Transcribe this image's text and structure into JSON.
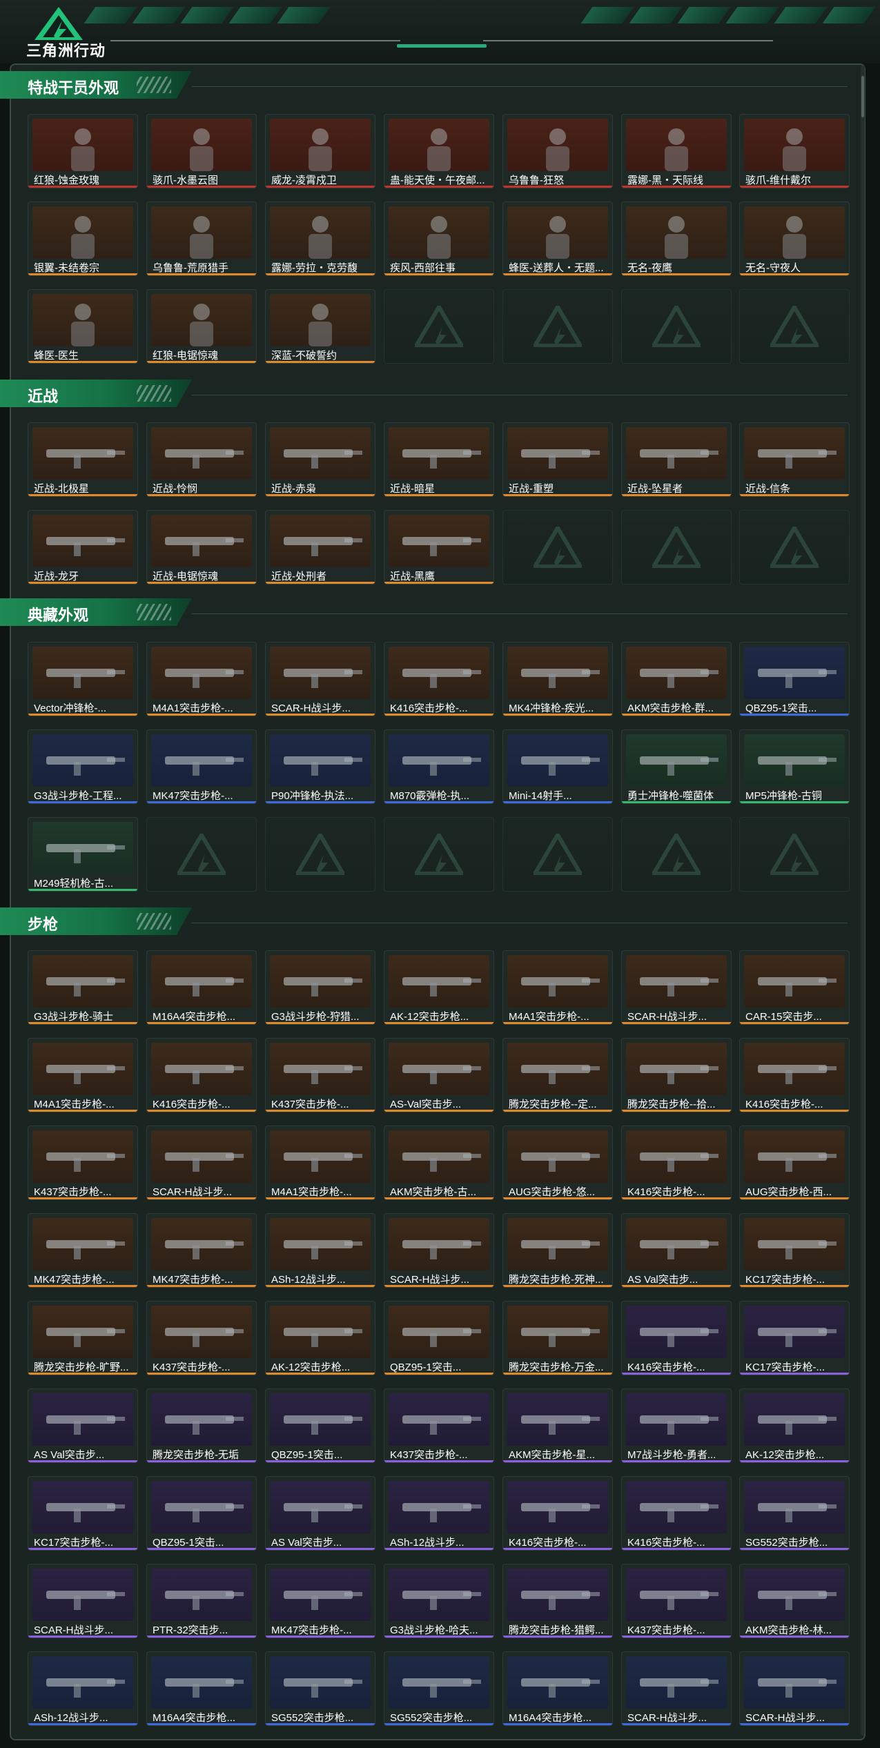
{
  "header": {
    "title": "三角洲行动"
  },
  "colors": {
    "accent": "#1f8a55",
    "red": "#c2332b",
    "gold": "#e0892c",
    "blue": "#3f69e0",
    "purple": "#8c5fe0",
    "green": "#34b86d"
  },
  "sections": [
    {
      "title": "特战干员外观",
      "items": [
        {
          "name": "红狼-蚀金玫瑰",
          "rarity": "red"
        },
        {
          "name": "骇爪-水墨云图",
          "rarity": "red"
        },
        {
          "name": "威龙-凌霄戍卫",
          "rarity": "red"
        },
        {
          "name": "蛊-能天使・午夜邮...",
          "rarity": "red"
        },
        {
          "name": "乌鲁鲁-狂怒",
          "rarity": "red"
        },
        {
          "name": "露娜-黑・天际线",
          "rarity": "red"
        },
        {
          "name": "骇爪-维什戴尔",
          "rarity": "red"
        },
        {
          "name": "银翼-未结卷宗",
          "rarity": "gold"
        },
        {
          "name": "乌鲁鲁-荒原猎手",
          "rarity": "gold"
        },
        {
          "name": "露娜-劳拉・克劳馥",
          "rarity": "gold"
        },
        {
          "name": "疾风-西部往事",
          "rarity": "gold"
        },
        {
          "name": "蜂医-送葬人・无题...",
          "rarity": "gold"
        },
        {
          "name": "无名-夜鹰",
          "rarity": "gold"
        },
        {
          "name": "无名-守夜人",
          "rarity": "gold"
        },
        {
          "name": "蜂医-医生",
          "rarity": "gold"
        },
        {
          "name": "红狼-电锯惊魂",
          "rarity": "gold"
        },
        {
          "name": "深蓝-不破誓约",
          "rarity": "gold"
        }
      ]
    },
    {
      "title": "近战",
      "items": [
        {
          "name": "近战-北极星",
          "rarity": "gold"
        },
        {
          "name": "近战-怜悯",
          "rarity": "gold"
        },
        {
          "name": "近战-赤枭",
          "rarity": "gold"
        },
        {
          "name": "近战-暗星",
          "rarity": "gold"
        },
        {
          "name": "近战-重塑",
          "rarity": "gold"
        },
        {
          "name": "近战-坠星者",
          "rarity": "gold"
        },
        {
          "name": "近战-信条",
          "rarity": "gold"
        },
        {
          "name": "近战-龙牙",
          "rarity": "gold"
        },
        {
          "name": "近战-电锯惊魂",
          "rarity": "gold"
        },
        {
          "name": "近战-处刑者",
          "rarity": "gold"
        },
        {
          "name": "近战-黑鹰",
          "rarity": "gold"
        }
      ]
    },
    {
      "title": "典藏外观",
      "items": [
        {
          "name": "Vector冲锋枪-...",
          "rarity": "gold"
        },
        {
          "name": "M4A1突击步枪-...",
          "rarity": "gold"
        },
        {
          "name": "SCAR-H战斗步...",
          "rarity": "gold"
        },
        {
          "name": "K416突击步枪-...",
          "rarity": "gold"
        },
        {
          "name": "MK4冲锋枪-疾光...",
          "rarity": "gold"
        },
        {
          "name": "AKM突击步枪-群...",
          "rarity": "gold"
        },
        {
          "name": "QBZ95-1突击...",
          "rarity": "blue"
        },
        {
          "name": "G3战斗步枪-工程...",
          "rarity": "blue"
        },
        {
          "name": "MK47突击步枪-...",
          "rarity": "blue"
        },
        {
          "name": "P90冲锋枪-执法...",
          "rarity": "blue"
        },
        {
          "name": "M870霰弹枪-执...",
          "rarity": "blue"
        },
        {
          "name": "Mini-14射手...",
          "rarity": "blue"
        },
        {
          "name": "勇士冲锋枪-噬菌体",
          "rarity": "green"
        },
        {
          "name": "MP5冲锋枪-古铜",
          "rarity": "green"
        },
        {
          "name": "M249轻机枪-古...",
          "rarity": "green"
        }
      ]
    },
    {
      "title": "步枪",
      "items": [
        {
          "name": "G3战斗步枪-骑士",
          "rarity": "gold"
        },
        {
          "name": "M16A4突击步枪...",
          "rarity": "gold"
        },
        {
          "name": "G3战斗步枪-狩猎...",
          "rarity": "gold"
        },
        {
          "name": "AK-12突击步枪...",
          "rarity": "gold"
        },
        {
          "name": "M4A1突击步枪-...",
          "rarity": "gold"
        },
        {
          "name": "SCAR-H战斗步...",
          "rarity": "gold"
        },
        {
          "name": "CAR-15突击步...",
          "rarity": "gold"
        },
        {
          "name": "M4A1突击步枪-...",
          "rarity": "gold"
        },
        {
          "name": "K416突击步枪-...",
          "rarity": "gold"
        },
        {
          "name": "K437突击步枪-...",
          "rarity": "gold"
        },
        {
          "name": "AS-Val突击步...",
          "rarity": "gold"
        },
        {
          "name": "腾龙突击步枪--定...",
          "rarity": "gold"
        },
        {
          "name": "腾龙突击步枪--拾...",
          "rarity": "gold"
        },
        {
          "name": "K416突击步枪-...",
          "rarity": "gold"
        },
        {
          "name": "K437突击步枪-...",
          "rarity": "gold"
        },
        {
          "name": "SCAR-H战斗步...",
          "rarity": "gold"
        },
        {
          "name": "M4A1突击步枪-...",
          "rarity": "gold"
        },
        {
          "name": "AKM突击步枪-古...",
          "rarity": "gold"
        },
        {
          "name": "AUG突击步枪-悠...",
          "rarity": "gold"
        },
        {
          "name": "K416突击步枪-...",
          "rarity": "gold"
        },
        {
          "name": "AUG突击步枪-西...",
          "rarity": "gold"
        },
        {
          "name": "MK47突击步枪-...",
          "rarity": "gold"
        },
        {
          "name": "MK47突击步枪-...",
          "rarity": "gold"
        },
        {
          "name": "ASh-12战斗步...",
          "rarity": "gold"
        },
        {
          "name": "SCAR-H战斗步...",
          "rarity": "gold"
        },
        {
          "name": "腾龙突击步枪-死神...",
          "rarity": "gold"
        },
        {
          "name": "AS Val突击步...",
          "rarity": "gold"
        },
        {
          "name": "KC17突击步枪-...",
          "rarity": "gold"
        },
        {
          "name": "腾龙突击步枪-旷野...",
          "rarity": "gold"
        },
        {
          "name": "K437突击步枪-...",
          "rarity": "gold"
        },
        {
          "name": "AK-12突击步枪...",
          "rarity": "gold"
        },
        {
          "name": "QBZ95-1突击...",
          "rarity": "gold"
        },
        {
          "name": "腾龙突击步枪-万金...",
          "rarity": "gold"
        },
        {
          "name": "K416突击步枪-...",
          "rarity": "purple"
        },
        {
          "name": "KC17突击步枪-...",
          "rarity": "purple"
        },
        {
          "name": "AS Val突击步...",
          "rarity": "purple"
        },
        {
          "name": "腾龙突击步枪-无垢",
          "rarity": "purple"
        },
        {
          "name": "QBZ95-1突击...",
          "rarity": "purple"
        },
        {
          "name": "K437突击步枪-...",
          "rarity": "purple"
        },
        {
          "name": "AKM突击步枪-星...",
          "rarity": "purple"
        },
        {
          "name": "M7战斗步枪-勇者...",
          "rarity": "purple"
        },
        {
          "name": "AK-12突击步枪...",
          "rarity": "purple"
        },
        {
          "name": "KC17突击步枪-...",
          "rarity": "purple"
        },
        {
          "name": "QBZ95-1突击...",
          "rarity": "purple"
        },
        {
          "name": "AS Val突击步...",
          "rarity": "purple"
        },
        {
          "name": "ASh-12战斗步...",
          "rarity": "purple"
        },
        {
          "name": "K416突击步枪-...",
          "rarity": "purple"
        },
        {
          "name": "K416突击步枪-...",
          "rarity": "purple"
        },
        {
          "name": "SG552突击步枪...",
          "rarity": "purple"
        },
        {
          "name": "SCAR-H战斗步...",
          "rarity": "purple"
        },
        {
          "name": "PTR-32突击步...",
          "rarity": "purple"
        },
        {
          "name": "MK47突击步枪-...",
          "rarity": "purple"
        },
        {
          "name": "G3战斗步枪-哈夫...",
          "rarity": "purple"
        },
        {
          "name": "腾龙突击步枪-猎鳄...",
          "rarity": "purple"
        },
        {
          "name": "K437突击步枪-...",
          "rarity": "purple"
        },
        {
          "name": "AKM突击步枪-林...",
          "rarity": "purple"
        },
        {
          "name": "ASh-12战斗步...",
          "rarity": "blue"
        },
        {
          "name": "M16A4突击步枪...",
          "rarity": "blue"
        },
        {
          "name": "SG552突击步枪...",
          "rarity": "blue"
        },
        {
          "name": "SG552突击步枪...",
          "rarity": "blue"
        },
        {
          "name": "M16A4突击步枪...",
          "rarity": "blue"
        },
        {
          "name": "SCAR-H战斗步...",
          "rarity": "blue"
        },
        {
          "name": "SCAR-H战斗步...",
          "rarity": "blue"
        }
      ]
    }
  ]
}
